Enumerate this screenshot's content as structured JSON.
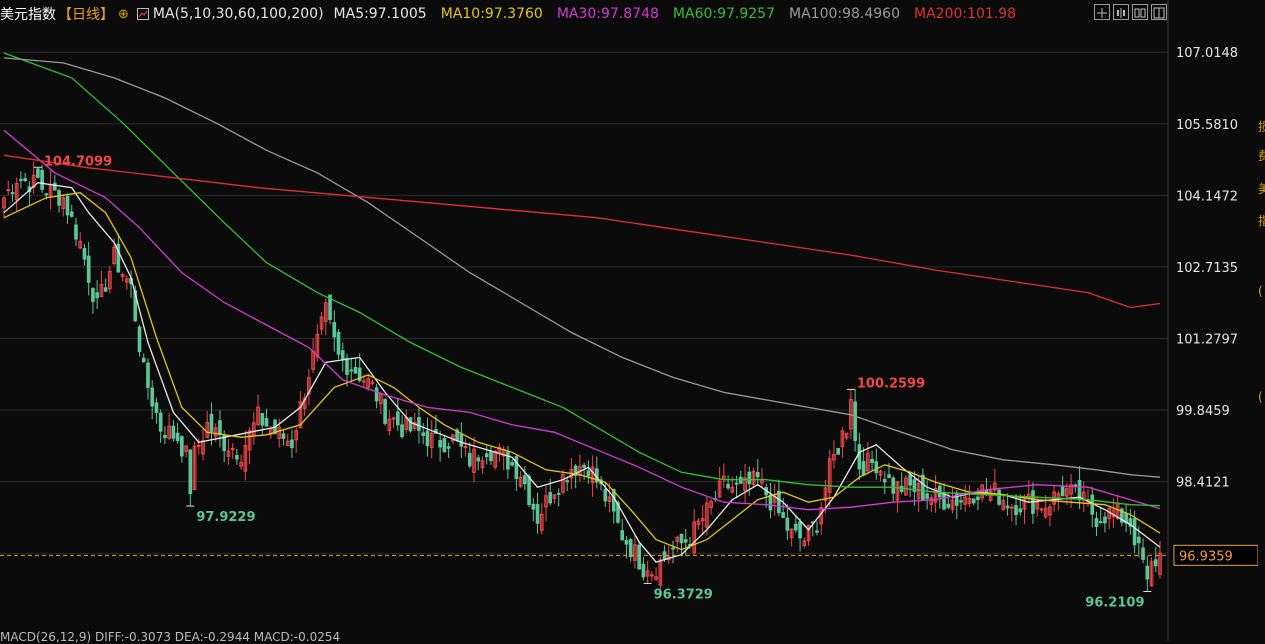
{
  "header": {
    "title": "美元指数",
    "period": "【日线】",
    "ma_label": "MA(5,10,30,60,100,200)",
    "ma_values": [
      {
        "text": "MA5:97.1005",
        "color": "#e8e8e8"
      },
      {
        "text": "MA10:97.3760",
        "color": "#e6c619"
      },
      {
        "text": "MA30:97.8748",
        "color": "#d43ad4"
      },
      {
        "text": "MA60:97.9257",
        "color": "#34c134"
      },
      {
        "text": "MA100:98.4960",
        "color": "#9a9a9a"
      },
      {
        "text": "MA200:101.98",
        "color": "#e03030"
      }
    ]
  },
  "colors": {
    "up": "#f04848",
    "down": "#5cc59a",
    "grid": "#2b2b2b",
    "axis_text": "#e6e6e6",
    "current": "#f0a030"
  },
  "chart_data": {
    "type": "candlestick",
    "ylim": [
      95.6,
      107.5
    ],
    "y_ticks": [
      "107.0148",
      "105.5810",
      "104.1472",
      "102.7135",
      "101.2797",
      "99.8459",
      "98.4121",
      "96.9784"
    ],
    "current_price": "96.9359",
    "annotations": [
      {
        "label": "104.7099",
        "index": 8,
        "value": 104.7099,
        "color": "#f04848"
      },
      {
        "label": "97.9229",
        "index": 44,
        "value": 97.9229,
        "color": "#5cc59a"
      },
      {
        "label": "100.2599",
        "index": 200,
        "value": 100.2599,
        "color": "#f04848"
      },
      {
        "label": "96.3729",
        "index": 152,
        "value": 96.3729,
        "color": "#5cc59a"
      },
      {
        "label": "96.2109",
        "index": 270,
        "value": 96.2109,
        "color": "#5cc59a"
      }
    ],
    "close_path": [
      [
        0,
        104.1
      ],
      [
        3,
        104.5
      ],
      [
        8,
        104.35
      ],
      [
        14,
        104.1
      ],
      [
        18,
        103.2
      ],
      [
        22,
        101.9
      ],
      [
        26,
        102.9
      ],
      [
        30,
        102.3
      ],
      [
        33,
        100.6
      ],
      [
        37,
        99.5
      ],
      [
        41,
        99.3
      ],
      [
        44,
        98.75
      ],
      [
        48,
        99.55
      ],
      [
        52,
        99.2
      ],
      [
        56,
        99.0
      ],
      [
        60,
        99.7
      ],
      [
        64,
        99.4
      ],
      [
        68,
        99.2
      ],
      [
        72,
        100.6
      ],
      [
        76,
        101.8
      ],
      [
        79,
        100.9
      ],
      [
        83,
        100.65
      ],
      [
        87,
        100.3
      ],
      [
        90,
        99.8
      ],
      [
        94,
        99.5
      ],
      [
        98,
        99.4
      ],
      [
        102,
        99.2
      ],
      [
        106,
        99.25
      ],
      [
        110,
        98.85
      ],
      [
        114,
        99.1
      ],
      [
        118,
        98.9
      ],
      [
        122,
        98.6
      ],
      [
        126,
        97.7
      ],
      [
        130,
        98.3
      ],
      [
        134,
        98.7
      ],
      [
        138,
        98.75
      ],
      [
        142,
        98.1
      ],
      [
        146,
        97.35
      ],
      [
        150,
        96.85
      ],
      [
        152,
        96.55
      ],
      [
        155,
        96.8
      ],
      [
        158,
        97.05
      ],
      [
        162,
        97.3
      ],
      [
        166,
        97.8
      ],
      [
        170,
        98.35
      ],
      [
        174,
        98.25
      ],
      [
        178,
        98.45
      ],
      [
        182,
        97.9
      ],
      [
        186,
        97.35
      ],
      [
        189,
        97.25
      ],
      [
        192,
        97.6
      ],
      [
        195,
        98.65
      ],
      [
        198,
        99.35
      ],
      [
        200,
        99.7
      ],
      [
        202,
        98.75
      ],
      [
        206,
        98.8
      ],
      [
        210,
        98.3
      ],
      [
        214,
        98.3
      ],
      [
        218,
        98.15
      ],
      [
        222,
        98.05
      ],
      [
        226,
        98.05
      ],
      [
        230,
        98.25
      ],
      [
        234,
        98.2
      ],
      [
        238,
        97.95
      ],
      [
        242,
        98.0
      ],
      [
        246,
        97.95
      ],
      [
        250,
        98.25
      ],
      [
        254,
        98.1
      ],
      [
        258,
        97.7
      ],
      [
        262,
        97.8
      ],
      [
        266,
        97.6
      ],
      [
        268,
        97.0
      ],
      [
        270,
        96.6
      ],
      [
        273,
        96.94
      ]
    ],
    "series": [
      {
        "name": "MA5",
        "color": "#e8e8e8",
        "points": [
          [
            0,
            103.8
          ],
          [
            8,
            104.4
          ],
          [
            16,
            104.3
          ],
          [
            20,
            103.8
          ],
          [
            26,
            103.2
          ],
          [
            30,
            102.5
          ],
          [
            34,
            101.2
          ],
          [
            40,
            99.8
          ],
          [
            46,
            99.2
          ],
          [
            52,
            99.3
          ],
          [
            58,
            99.4
          ],
          [
            64,
            99.5
          ],
          [
            70,
            99.9
          ],
          [
            76,
            100.8
          ],
          [
            84,
            100.9
          ],
          [
            90,
            100.2
          ],
          [
            96,
            99.6
          ],
          [
            102,
            99.4
          ],
          [
            108,
            99.2
          ],
          [
            114,
            99.05
          ],
          [
            120,
            98.9
          ],
          [
            126,
            98.3
          ],
          [
            132,
            98.45
          ],
          [
            138,
            98.7
          ],
          [
            144,
            98.1
          ],
          [
            150,
            97.2
          ],
          [
            154,
            96.8
          ],
          [
            160,
            96.95
          ],
          [
            166,
            97.45
          ],
          [
            172,
            98.05
          ],
          [
            178,
            98.35
          ],
          [
            184,
            98.0
          ],
          [
            190,
            97.45
          ],
          [
            196,
            98.1
          ],
          [
            202,
            99.0
          ],
          [
            206,
            99.15
          ],
          [
            212,
            98.7
          ],
          [
            218,
            98.3
          ],
          [
            224,
            98.1
          ],
          [
            230,
            98.2
          ],
          [
            236,
            98.15
          ],
          [
            242,
            98.0
          ],
          [
            248,
            98.05
          ],
          [
            254,
            98.1
          ],
          [
            260,
            97.85
          ],
          [
            266,
            97.55
          ],
          [
            273,
            97.1
          ]
        ]
      },
      {
        "name": "MA10",
        "color": "#e6c619",
        "points": [
          [
            0,
            103.7
          ],
          [
            10,
            104.1
          ],
          [
            18,
            104.2
          ],
          [
            24,
            103.8
          ],
          [
            30,
            102.9
          ],
          [
            36,
            101.3
          ],
          [
            42,
            99.9
          ],
          [
            48,
            99.4
          ],
          [
            56,
            99.3
          ],
          [
            62,
            99.35
          ],
          [
            70,
            99.55
          ],
          [
            78,
            100.3
          ],
          [
            86,
            100.55
          ],
          [
            92,
            100.3
          ],
          [
            98,
            99.9
          ],
          [
            104,
            99.55
          ],
          [
            112,
            99.2
          ],
          [
            120,
            99.0
          ],
          [
            128,
            98.65
          ],
          [
            136,
            98.55
          ],
          [
            142,
            98.4
          ],
          [
            148,
            97.85
          ],
          [
            154,
            97.25
          ],
          [
            160,
            97.05
          ],
          [
            166,
            97.25
          ],
          [
            172,
            97.65
          ],
          [
            178,
            98.05
          ],
          [
            184,
            98.2
          ],
          [
            190,
            98.0
          ],
          [
            196,
            98.1
          ],
          [
            202,
            98.5
          ],
          [
            208,
            98.75
          ],
          [
            214,
            98.6
          ],
          [
            220,
            98.4
          ],
          [
            228,
            98.2
          ],
          [
            236,
            98.15
          ],
          [
            244,
            98.05
          ],
          [
            252,
            98.0
          ],
          [
            260,
            97.95
          ],
          [
            266,
            97.75
          ],
          [
            273,
            97.38
          ]
        ]
      },
      {
        "name": "MA30",
        "color": "#d43ad4",
        "points": [
          [
            0,
            105.45
          ],
          [
            12,
            104.6
          ],
          [
            24,
            104.1
          ],
          [
            32,
            103.5
          ],
          [
            42,
            102.6
          ],
          [
            52,
            102.0
          ],
          [
            62,
            101.55
          ],
          [
            72,
            101.1
          ],
          [
            80,
            100.45
          ],
          [
            90,
            100.15
          ],
          [
            100,
            99.9
          ],
          [
            110,
            99.8
          ],
          [
            120,
            99.55
          ],
          [
            130,
            99.4
          ],
          [
            140,
            99.05
          ],
          [
            150,
            98.7
          ],
          [
            160,
            98.3
          ],
          [
            170,
            98.0
          ],
          [
            180,
            97.95
          ],
          [
            190,
            97.85
          ],
          [
            200,
            97.9
          ],
          [
            210,
            98.0
          ],
          [
            220,
            98.05
          ],
          [
            232,
            98.25
          ],
          [
            244,
            98.35
          ],
          [
            256,
            98.3
          ],
          [
            266,
            98.05
          ],
          [
            273,
            97.87
          ]
        ]
      },
      {
        "name": "MA60",
        "color": "#34c134",
        "points": [
          [
            0,
            107.0
          ],
          [
            16,
            106.5
          ],
          [
            28,
            105.6
          ],
          [
            40,
            104.6
          ],
          [
            52,
            103.6
          ],
          [
            62,
            102.8
          ],
          [
            74,
            102.2
          ],
          [
            84,
            101.8
          ],
          [
            96,
            101.2
          ],
          [
            108,
            100.7
          ],
          [
            120,
            100.3
          ],
          [
            132,
            99.9
          ],
          [
            142,
            99.4
          ],
          [
            150,
            99.0
          ],
          [
            160,
            98.6
          ],
          [
            170,
            98.45
          ],
          [
            180,
            98.45
          ],
          [
            190,
            98.35
          ],
          [
            200,
            98.3
          ],
          [
            210,
            98.3
          ],
          [
            220,
            98.2
          ],
          [
            232,
            98.15
          ],
          [
            244,
            98.1
          ],
          [
            256,
            98.05
          ],
          [
            266,
            97.95
          ],
          [
            273,
            97.93
          ]
        ]
      },
      {
        "name": "MA100",
        "color": "#9a9a9a",
        "points": [
          [
            0,
            106.9
          ],
          [
            14,
            106.8
          ],
          [
            26,
            106.5
          ],
          [
            38,
            106.1
          ],
          [
            50,
            105.6
          ],
          [
            62,
            105.05
          ],
          [
            74,
            104.6
          ],
          [
            86,
            104.0
          ],
          [
            98,
            103.3
          ],
          [
            110,
            102.6
          ],
          [
            122,
            102.0
          ],
          [
            134,
            101.4
          ],
          [
            146,
            100.9
          ],
          [
            158,
            100.5
          ],
          [
            170,
            100.2
          ],
          [
            180,
            100.05
          ],
          [
            190,
            99.9
          ],
          [
            200,
            99.75
          ],
          [
            212,
            99.4
          ],
          [
            224,
            99.05
          ],
          [
            236,
            98.85
          ],
          [
            248,
            98.75
          ],
          [
            258,
            98.65
          ],
          [
            266,
            98.55
          ],
          [
            273,
            98.5
          ]
        ]
      },
      {
        "name": "MA200",
        "color": "#e03030",
        "points": [
          [
            0,
            104.95
          ],
          [
            20,
            104.7
          ],
          [
            40,
            104.5
          ],
          [
            60,
            104.3
          ],
          [
            80,
            104.15
          ],
          [
            100,
            104.0
          ],
          [
            120,
            103.85
          ],
          [
            140,
            103.7
          ],
          [
            160,
            103.45
          ],
          [
            180,
            103.2
          ],
          [
            200,
            102.95
          ],
          [
            220,
            102.65
          ],
          [
            240,
            102.4
          ],
          [
            256,
            102.2
          ],
          [
            266,
            101.9
          ],
          [
            273,
            101.98
          ]
        ]
      }
    ]
  },
  "right_strip": [
    {
      "text": "损",
      "y": 118
    },
    {
      "text": "费",
      "y": 147
    },
    {
      "text": "美",
      "y": 180
    },
    {
      "text": "指",
      "y": 212
    },
    {
      "text": "(",
      "y": 284
    },
    {
      "text": "(",
      "y": 390
    }
  ],
  "macd": {
    "text": "MACD(26,12,9) DIFF:-0.3073  DEA:-0.2944  MACD:-0.0254"
  }
}
